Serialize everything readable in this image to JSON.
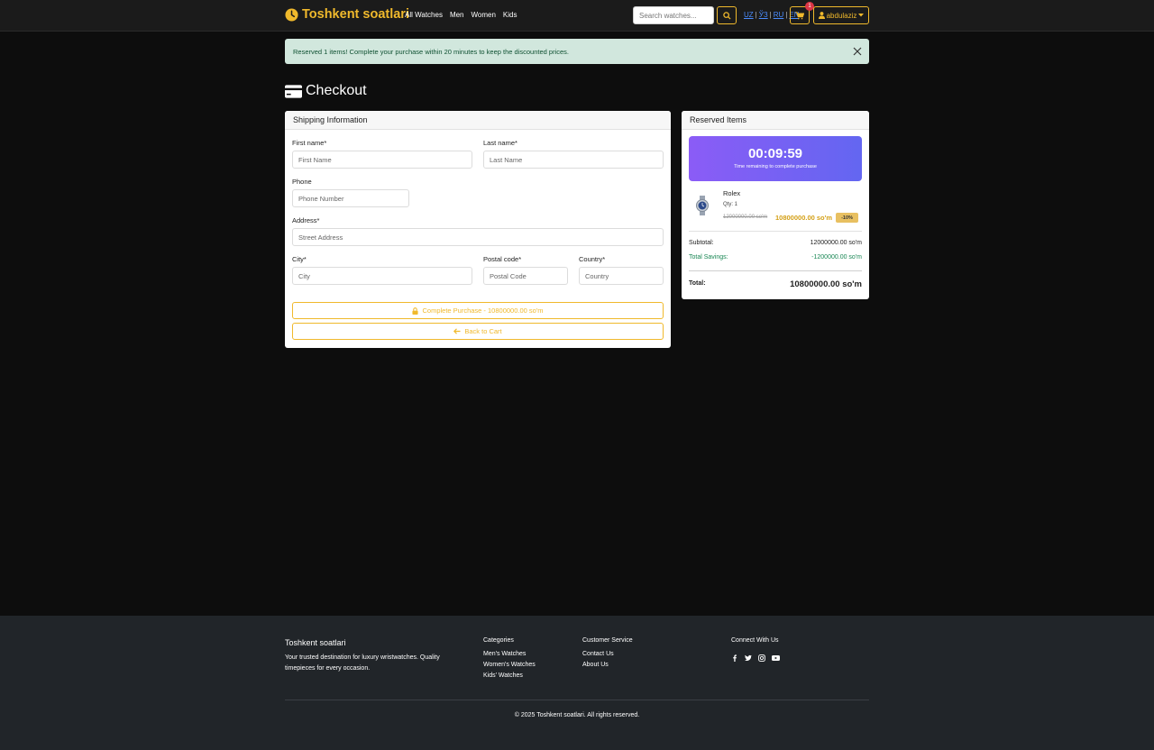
{
  "nav": {
    "brand": "Toshkent soatlari",
    "links": [
      "All Watches",
      "Men",
      "Women",
      "Kids"
    ],
    "search_placeholder": "Search watches...",
    "langs": [
      "UZ",
      "ЎЗ",
      "RU",
      "EN"
    ],
    "cart_count": "1",
    "user": "abdulaziz"
  },
  "alert": {
    "text": "Reserved 1 items! Complete your purchase within 20 minutes to keep the discounted prices."
  },
  "page_title": "Checkout",
  "shipping": {
    "header": "Shipping Information",
    "first_name_label": "First name*",
    "first_name_placeholder": "First Name",
    "last_name_label": "Last name*",
    "last_name_placeholder": "Last Name",
    "phone_label": "Phone",
    "phone_placeholder": "Phone Number",
    "address_label": "Address*",
    "address_placeholder": "Street Address",
    "city_label": "City*",
    "city_placeholder": "City",
    "postal_label": "Postal code*",
    "postal_placeholder": "Postal Code",
    "country_label": "Country*",
    "country_placeholder": "Country",
    "complete_button": "Complete Purchase - 10800000.00 so'm",
    "back_button": "Back to Cart"
  },
  "reserved": {
    "header": "Reserved Items",
    "timer": "00:09:59",
    "timer_label": "Time remaining to complete purchase",
    "item": {
      "name": "Rolex",
      "qty": "Qty: 1",
      "old_price": "12000000.00 so'm",
      "new_price": "10800000.00 so'm",
      "discount": "-10%"
    },
    "subtotal_label": "Subtotal:",
    "subtotal": "12000000.00 so'm",
    "savings_label": "Total Savings:",
    "savings": "-1200000.00 so'm",
    "total_label": "Total:",
    "total": "10800000.00 so'm"
  },
  "footer": {
    "brand": "Toshkent soatlari",
    "desc": "Your trusted destination for luxury wristwatches. Quality timepieces for every occasion.",
    "categories_head": "Categories",
    "categories": [
      "Men's Watches",
      "Women's Watches",
      "Kids' Watches"
    ],
    "service_head": "Customer Service",
    "service": [
      "Contact Us",
      "About Us"
    ],
    "connect_head": "Connect With Us",
    "copyright": "© 2025 Toshkent soatlari. All rights reserved."
  },
  "colors": {
    "accent": "#f0b92c",
    "savings": "#198754",
    "alert_bg": "#d1e7dd"
  }
}
